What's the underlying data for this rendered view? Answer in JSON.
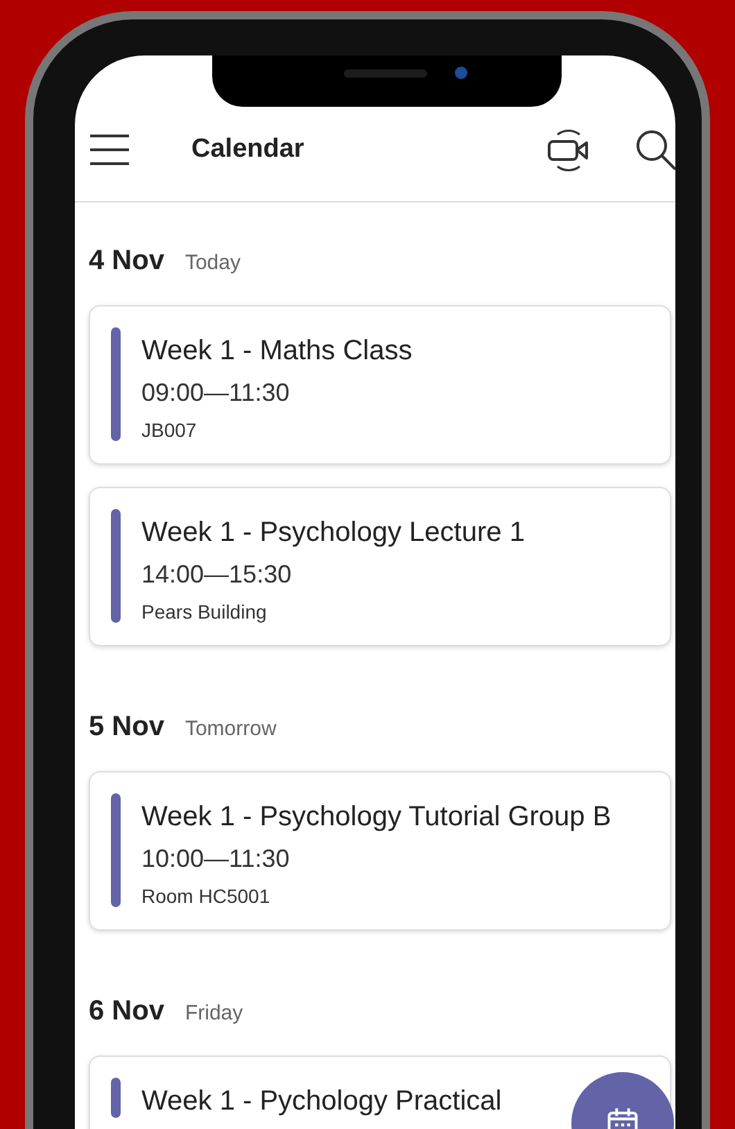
{
  "header": {
    "title": "Calendar"
  },
  "days": [
    {
      "date": "4 Nov",
      "label": "Today",
      "events": [
        {
          "title": "Week 1 - Maths Class",
          "time": "09:00—11:30",
          "location": "JB007"
        },
        {
          "title": "Week 1 - Psychology Lecture 1",
          "time": "14:00—15:30",
          "location": "Pears Building"
        }
      ]
    },
    {
      "date": "5 Nov",
      "label": "Tomorrow",
      "events": [
        {
          "title": "Week 1 - Psychology Tutorial Group B",
          "time": "10:00—11:30",
          "location": "Room HC5001"
        }
      ]
    },
    {
      "date": "6 Nov",
      "label": "Friday",
      "events": [
        {
          "title": "Week 1 - Pychology Practical"
        }
      ]
    }
  ]
}
